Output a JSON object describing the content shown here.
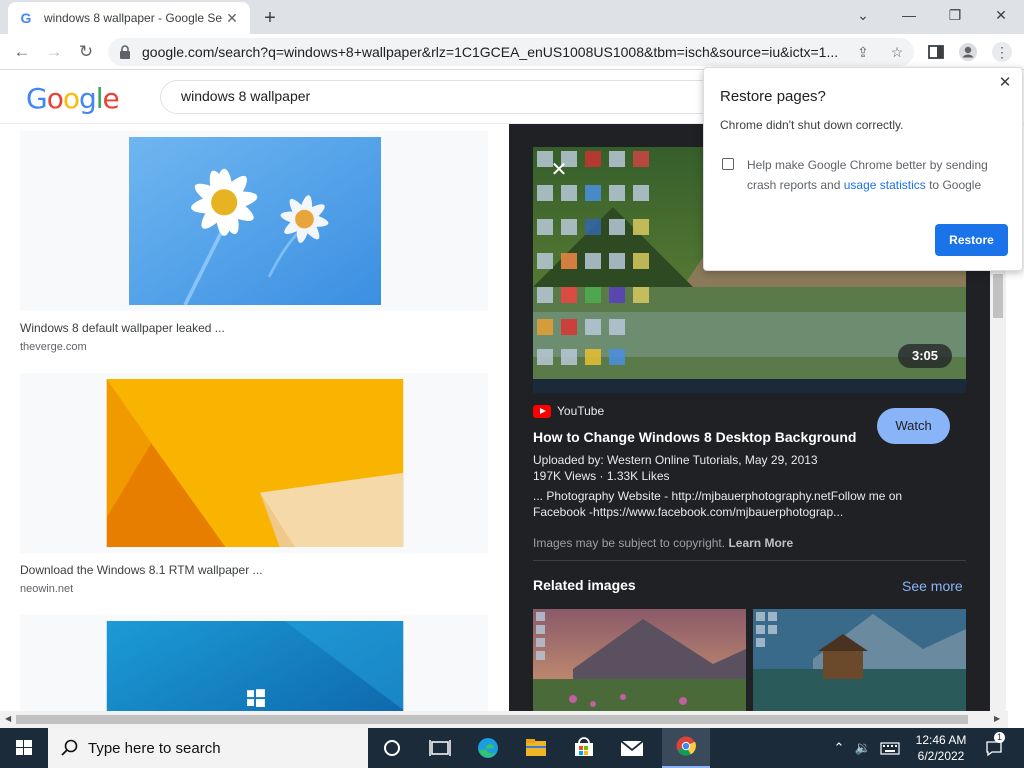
{
  "browser": {
    "tab_title": "windows 8 wallpaper - Google Se",
    "favicon": "G",
    "new_tab": "+",
    "url": "google.com/search?q=windows+8+wallpaper&rlz=1C1GCEA_enUS1008US1008&tbm=isch&source=iu&ictx=1..."
  },
  "google": {
    "logo": [
      "G",
      "o",
      "o",
      "g",
      "l",
      "e"
    ],
    "logo_colors": [
      "#4285f4",
      "#ea4335",
      "#fbbc05",
      "#4285f4",
      "#34a853",
      "#ea4335"
    ],
    "query": "windows 8 wallpaper"
  },
  "results": [
    {
      "title": "Windows 8 default wallpaper leaked ...",
      "source": "theverge.com"
    },
    {
      "title": "Download the Windows 8.1 RTM wallpaper ...",
      "source": "neowin.net"
    },
    {
      "title": "",
      "source": ""
    }
  ],
  "preview": {
    "duration": "3:05",
    "channel": "YouTube",
    "title": "How to Change Windows 8 Desktop Background",
    "watch": "Watch",
    "uploaded": "Uploaded by: Western Online Tutorials, May 29, 2013",
    "stats": "197K Views  ·  1.33K Likes",
    "description": "... Photography Website - http://mjbauerphotography.netFollow me on Facebook -https://www.facebook.com/mjbauerphotograp...",
    "copyright": "Images may be subject to copyright.",
    "learn_more": "Learn More",
    "related_title": "Related images",
    "see_more": "See more"
  },
  "popup": {
    "title": "Restore pages?",
    "message": "Chrome didn't shut down correctly.",
    "checkbox_pre": "Help make Google Chrome better by sending crash reports and ",
    "checkbox_link": "usage statistics",
    "checkbox_post": " to Google",
    "restore": "Restore"
  },
  "taskbar": {
    "search_placeholder": "Type here to search",
    "time": "12:46 AM",
    "date": "6/2/2022",
    "notification_count": "1"
  },
  "colors": {
    "accent": "#1a73e8",
    "panel_bg": "#202124",
    "watch_btn": "#8ab4f8",
    "taskbar": "#1c2b3a"
  }
}
